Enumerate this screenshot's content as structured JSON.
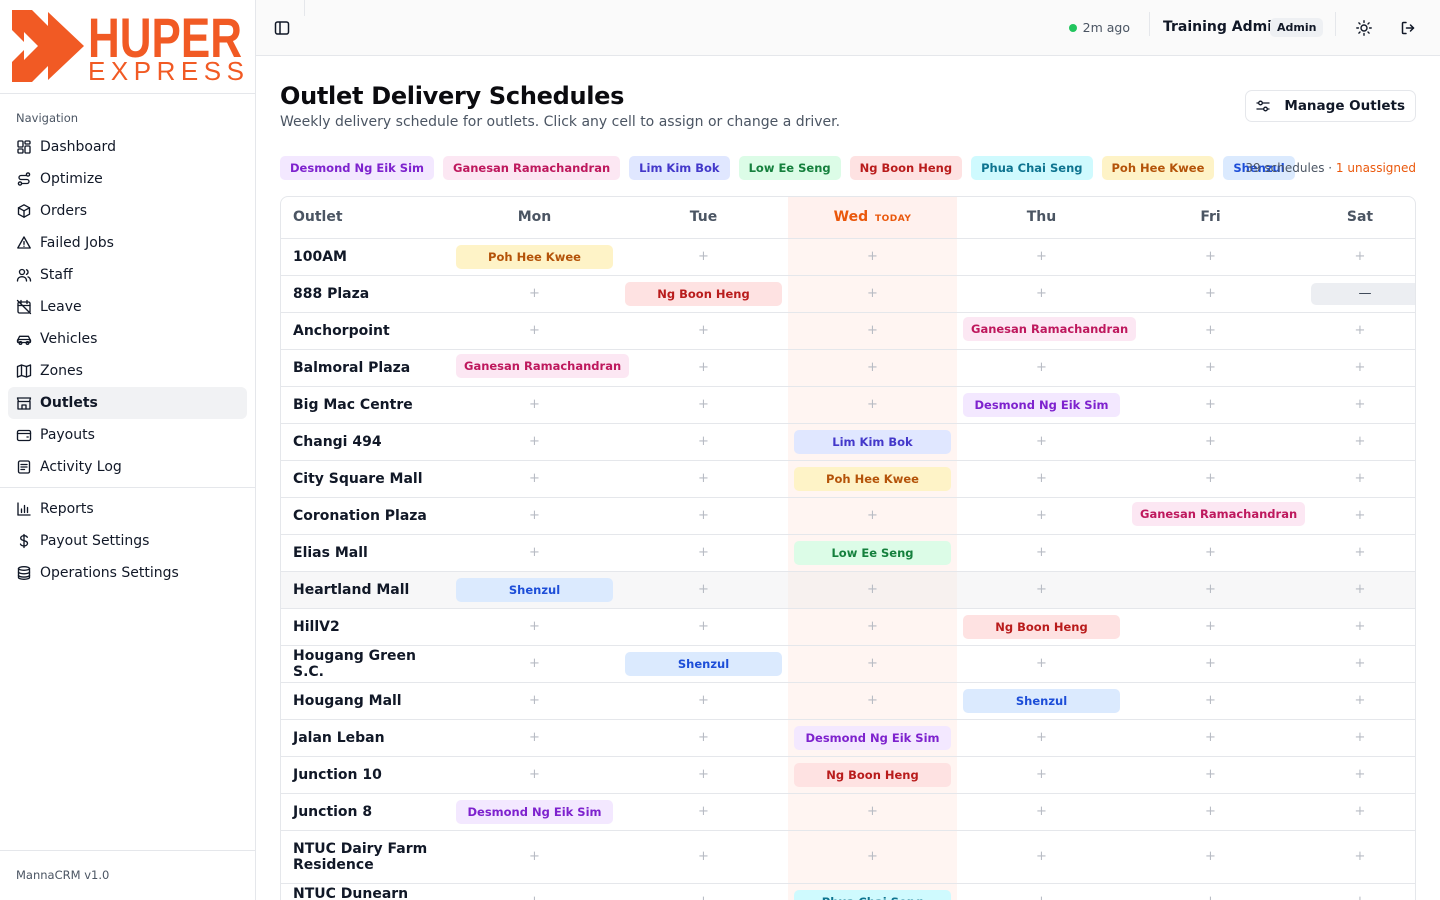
{
  "brand": {
    "name_top": "HUPER",
    "name_bottom": "EXPRESS"
  },
  "nav": {
    "heading": "Navigation",
    "items": [
      {
        "label": "Dashboard",
        "icon": "dashboard-icon"
      },
      {
        "label": "Optimize",
        "icon": "route-icon"
      },
      {
        "label": "Orders",
        "icon": "package-icon"
      },
      {
        "label": "Failed Jobs",
        "icon": "warning-icon"
      },
      {
        "label": "Staff",
        "icon": "users-icon"
      },
      {
        "label": "Leave",
        "icon": "calendar-off-icon"
      },
      {
        "label": "Vehicles",
        "icon": "car-icon"
      },
      {
        "label": "Zones",
        "icon": "map-icon"
      },
      {
        "label": "Outlets",
        "icon": "store-icon",
        "active": true
      },
      {
        "label": "Payouts",
        "icon": "wallet-icon"
      },
      {
        "label": "Activity Log",
        "icon": "activity-log-icon"
      }
    ],
    "secondary": [
      {
        "label": "Reports",
        "icon": "bar-chart-icon"
      },
      {
        "label": "Payout Settings",
        "icon": "dollar-icon"
      },
      {
        "label": "Operations Settings",
        "icon": "database-icon"
      }
    ],
    "footer": "MannaCRM v1.0"
  },
  "topbar": {
    "status_text": "2m ago",
    "user_name": "Training Admin",
    "role": "Admin"
  },
  "page": {
    "title": "Outlet Delivery Schedules",
    "subtitle": "Weekly delivery schedule for outlets. Click any cell to assign or change a driver.",
    "manage_button": "Manage Outlets",
    "summary_count": "39 schedules",
    "summary_sep": " · ",
    "summary_unassigned": "1 unassigned"
  },
  "drivers": [
    {
      "name": "Desmond Ng Eik Sim",
      "bg": "#f3e8ff",
      "fg": "#7e22ce"
    },
    {
      "name": "Ganesan Ramachandran",
      "bg": "#fce7f3",
      "fg": "#be185d"
    },
    {
      "name": "Lim Kim Bok",
      "bg": "#e0e7ff",
      "fg": "#4338ca"
    },
    {
      "name": "Low Ee Seng",
      "bg": "#dcfce7",
      "fg": "#15803d"
    },
    {
      "name": "Ng Boon Heng",
      "bg": "#fee2e2",
      "fg": "#b91c1c"
    },
    {
      "name": "Phua Chai Seng",
      "bg": "#cffafe",
      "fg": "#0e7490"
    },
    {
      "name": "Poh Hee Kwee",
      "bg": "#fef3c7",
      "fg": "#b45309"
    },
    {
      "name": "Shenzul",
      "bg": "#dbeafe",
      "fg": "#1d4ed8"
    }
  ],
  "table": {
    "outlet_header": "Outlet",
    "days": [
      "Mon",
      "Tue",
      "Wed",
      "Thu",
      "Fri",
      "Sat"
    ],
    "today_index": 2,
    "today_label": "TODAY",
    "empty_symbol": "+",
    "unassigned_symbol": "—",
    "rows": [
      {
        "outlet": "100AM",
        "cells": [
          "Poh Hee Kwee",
          "",
          "",
          "",
          "",
          ""
        ]
      },
      {
        "outlet": "888 Plaza",
        "cells": [
          "",
          "Ng Boon Heng",
          "",
          "",
          "",
          "—"
        ]
      },
      {
        "outlet": "Anchorpoint",
        "cells": [
          "",
          "",
          "",
          "Ganesan Ramachandran",
          "",
          ""
        ]
      },
      {
        "outlet": "Balmoral Plaza",
        "cells": [
          "Ganesan Ramachandran",
          "",
          "",
          "",
          "",
          ""
        ]
      },
      {
        "outlet": "Big Mac Centre",
        "cells": [
          "",
          "",
          "",
          "Desmond Ng Eik Sim",
          "",
          ""
        ]
      },
      {
        "outlet": "Changi 494",
        "cells": [
          "",
          "",
          "Lim Kim Bok",
          "",
          "",
          ""
        ]
      },
      {
        "outlet": "City Square Mall",
        "cells": [
          "",
          "",
          "Poh Hee Kwee",
          "",
          "",
          ""
        ]
      },
      {
        "outlet": "Coronation Plaza",
        "cells": [
          "",
          "",
          "",
          "",
          "Ganesan Ramachandran",
          ""
        ]
      },
      {
        "outlet": "Elias Mall",
        "cells": [
          "",
          "",
          "Low Ee Seng",
          "",
          "",
          ""
        ]
      },
      {
        "outlet": "Heartland Mall",
        "cells": [
          "Shenzul",
          "",
          "",
          "",
          "",
          ""
        ],
        "highlight": true
      },
      {
        "outlet": "HillV2",
        "cells": [
          "",
          "",
          "",
          "Ng Boon Heng",
          "",
          ""
        ]
      },
      {
        "outlet": "Hougang Green S.C.",
        "cells": [
          "",
          "Shenzul",
          "",
          "",
          "",
          ""
        ]
      },
      {
        "outlet": "Hougang Mall",
        "cells": [
          "",
          "",
          "",
          "Shenzul",
          "",
          ""
        ]
      },
      {
        "outlet": "Jalan Leban",
        "cells": [
          "",
          "",
          "Desmond Ng Eik Sim",
          "",
          "",
          ""
        ]
      },
      {
        "outlet": "Junction 10",
        "cells": [
          "",
          "",
          "Ng Boon Heng",
          "",
          "",
          ""
        ]
      },
      {
        "outlet": "Junction 8",
        "cells": [
          "Desmond Ng Eik Sim",
          "",
          "",
          "",
          "",
          ""
        ]
      },
      {
        "outlet": "NTUC Dairy Farm Residence",
        "cells": [
          "",
          "",
          "",
          "",
          "",
          ""
        ],
        "tall": true
      },
      {
        "outlet": "NTUC Dunearn Village",
        "cells": [
          "",
          "",
          "Phua Chai Seng",
          "",
          "",
          ""
        ]
      }
    ]
  }
}
